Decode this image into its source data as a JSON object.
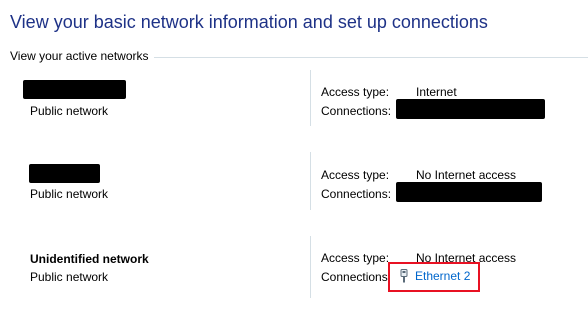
{
  "header": {
    "title": "View your basic network information and set up connections",
    "section_label": "View your active networks"
  },
  "labels": {
    "access_type": "Access type:",
    "connections": "Connections:"
  },
  "networks": [
    {
      "name": "",
      "category": "Public network",
      "access_type": "Internet",
      "connection": ""
    },
    {
      "name": "",
      "category": "Public network",
      "access_type": "No Internet access",
      "connection": ""
    },
    {
      "name": "Unidentified network",
      "category": "Public network",
      "access_type": "No Internet access",
      "connection": "Ethernet 2"
    }
  ],
  "colors": {
    "title": "#1e3287",
    "link": "#0066cc",
    "highlight": "#e81123"
  },
  "icons": {
    "connection": "ethernet-icon"
  }
}
